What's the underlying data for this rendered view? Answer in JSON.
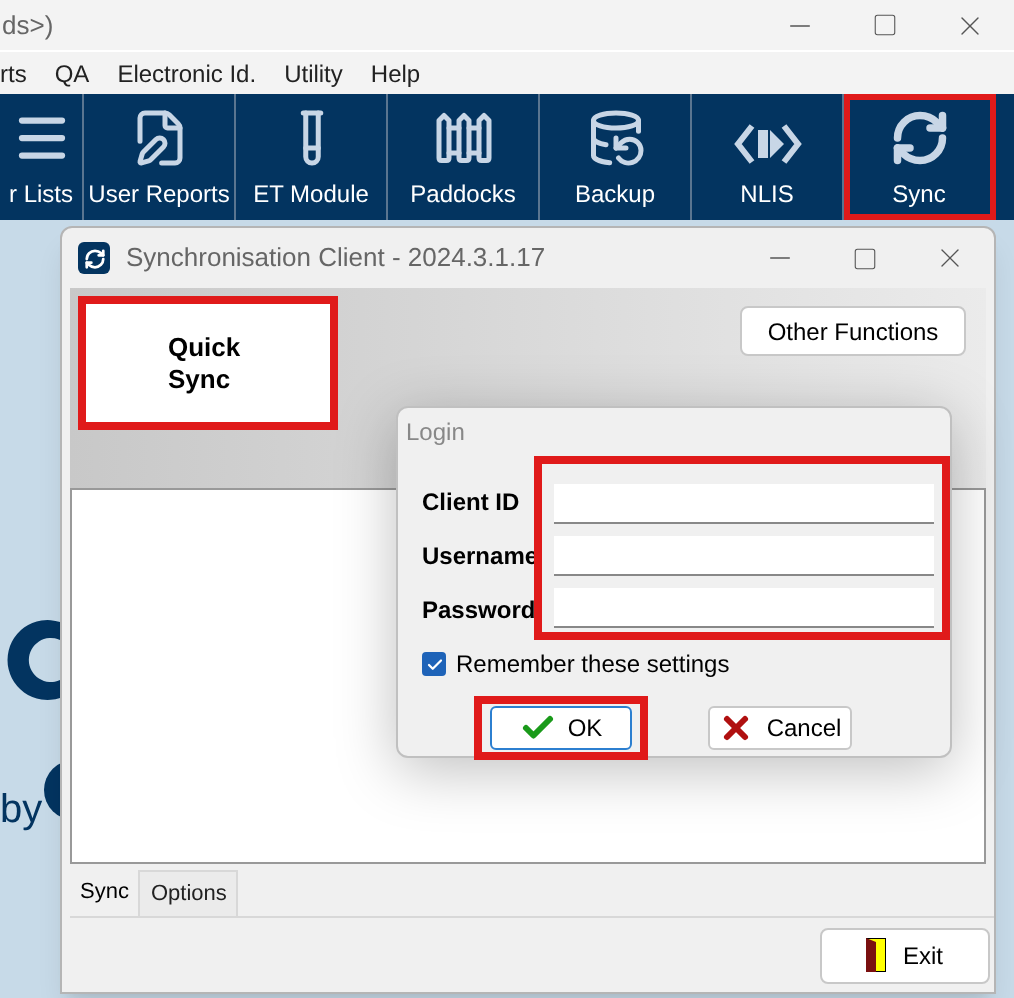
{
  "main_window": {
    "title": "ds>)",
    "menu": [
      "rts",
      "QA",
      "Electronic Id.",
      "Utility",
      "Help"
    ],
    "toolbar": [
      {
        "label": "r Lists",
        "highlighted": false
      },
      {
        "label": "User Reports",
        "highlighted": false
      },
      {
        "label": "ET Module",
        "highlighted": false
      },
      {
        "label": "Paddocks",
        "highlighted": false
      },
      {
        "label": "Backup",
        "highlighted": false
      },
      {
        "label": "NLIS",
        "highlighted": false
      },
      {
        "label": "Sync",
        "highlighted": true
      }
    ],
    "background_text": [
      "by"
    ]
  },
  "sync_window": {
    "title": "Synchronisation Client - 2024.3.1.17",
    "quick_sync": {
      "label": "Quick Sync",
      "highlighted": true
    },
    "other_functions": "Other Functions",
    "tabs": [
      {
        "label": "Sync",
        "selected": true
      },
      {
        "label": "Options",
        "selected": false
      }
    ],
    "exit": "Exit"
  },
  "login": {
    "title": "Login",
    "fields_highlighted": true,
    "fields": [
      {
        "label": "Client ID"
      },
      {
        "label": "Username"
      },
      {
        "label": "Password"
      }
    ],
    "remember": {
      "label": "Remember these settings",
      "checked": true
    },
    "buttons": [
      {
        "label": "OK",
        "kind": "ok",
        "highlighted": true
      },
      {
        "label": "Cancel",
        "kind": "cancel",
        "highlighted": false
      }
    ]
  }
}
